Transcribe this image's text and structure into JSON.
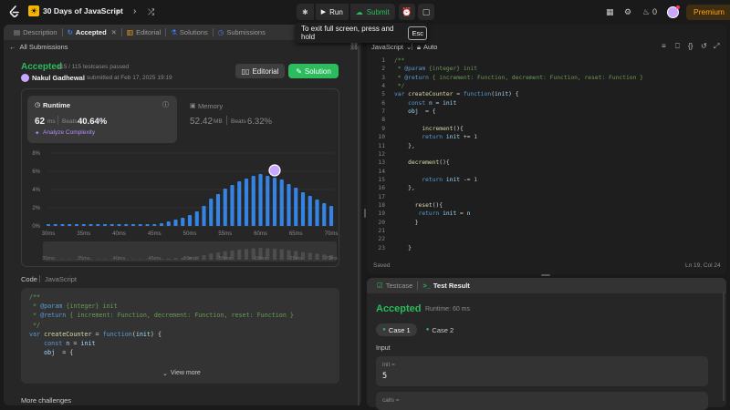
{
  "topbar": {
    "list_title": "30 Days of JavaScript",
    "run_label": "Run",
    "submit_label": "Submit",
    "streak_count": "0",
    "premium_label": "Premium"
  },
  "tooltip": {
    "text": "To exit full screen, press and hold",
    "key": "Esc"
  },
  "left_panel": {
    "tabs": [
      "Description",
      "Accepted",
      "Editorial",
      "Solutions",
      "Submissions"
    ],
    "back_link": "All Submissions",
    "status": "Accepted",
    "testcases": "115 / 115 testcases passed",
    "user_name": "Nakul Gadhewal",
    "submitted_at": "submitted at Feb 17, 2025 19:19",
    "editorial_btn": "Editorial",
    "solution_btn": "Solution",
    "runtime_label": "Runtime",
    "runtime_value": "62",
    "runtime_unit": "ms",
    "beats_label": "Beats",
    "runtime_beats": "40.64%",
    "analyze_label": "Analyze Complexity",
    "memory_label": "Memory",
    "memory_value": "52.42",
    "memory_unit": "MB",
    "memory_beats": "6.32%",
    "code_label": "Code",
    "code_lang": "JavaScript",
    "view_more": "View more",
    "more_challenges": "More challenges"
  },
  "chart_data": {
    "type": "bar",
    "x_tick_labels": [
      "30ms",
      "35ms",
      "40ms",
      "45ms",
      "50ms",
      "55ms",
      "60ms",
      "65ms",
      "70ms"
    ],
    "y_tick_labels": [
      "0%",
      "2%",
      "4%",
      "6%",
      "8%"
    ],
    "ylim": [
      0,
      8
    ],
    "x": [
      30,
      31,
      32,
      33,
      34,
      35,
      36,
      37,
      38,
      39,
      40,
      41,
      42,
      43,
      44,
      45,
      46,
      47,
      48,
      49,
      50,
      51,
      52,
      53,
      54,
      55,
      56,
      57,
      58,
      59,
      60,
      61,
      62,
      63,
      64,
      65,
      66,
      67,
      68,
      69,
      70
    ],
    "values": [
      0.2,
      0.2,
      0.2,
      0.2,
      0.2,
      0.2,
      0.2,
      0.2,
      0.2,
      0.2,
      0.2,
      0.2,
      0.2,
      0.2,
      0.2,
      0.2,
      0.3,
      0.5,
      0.7,
      0.9,
      1.2,
      1.6,
      2.2,
      3.0,
      3.5,
      4.1,
      4.5,
      4.9,
      5.2,
      5.5,
      5.7,
      5.5,
      5.3,
      5.1,
      4.6,
      4.2,
      3.7,
      3.3,
      2.9,
      2.5,
      2.2
    ],
    "highlighted_x": 62,
    "grid": true,
    "color": "#3584e4"
  },
  "code_preview": [
    "/**",
    " * @param {integer} init",
    " * @return { increment: Function, decrement: Function, reset: Function }",
    " */",
    "var createCounter = function(init) {",
    "    const n = init",
    "    obj  = {"
  ],
  "editor": {
    "language": "JavaScript",
    "mode": "Auto",
    "saved_label": "Saved",
    "cursor_pos": "Ln 19, Col 24",
    "lines": [
      "/**",
      " * @param {integer} init",
      " * @return { increment: Function, decrement: Function, reset: Function }",
      " */",
      "var createCounter = function(init) {",
      "    const n = init",
      "    obj  = {",
      "",
      "        increment(){",
      "        return init += 1",
      "    },",
      "",
      "    decrement(){",
      "",
      "        return init -= 1",
      "    },",
      "",
      "      reset(){",
      "       return init = n",
      "      }",
      "",
      "",
      "    }"
    ]
  },
  "result_panel": {
    "testcase_tab": "Testcase",
    "result_tab": "Test Result",
    "status": "Accepted",
    "runtime": "Runtime: 60 ms",
    "case1": "Case 1",
    "case2": "Case 2",
    "input_label": "Input",
    "field1_name": "init =",
    "field1_value": "5",
    "field2_name": "calls ="
  },
  "colors": {
    "accent_green": "#2cbb5d",
    "accent_orange": "#ffa116",
    "bar_blue": "#3584e4"
  }
}
